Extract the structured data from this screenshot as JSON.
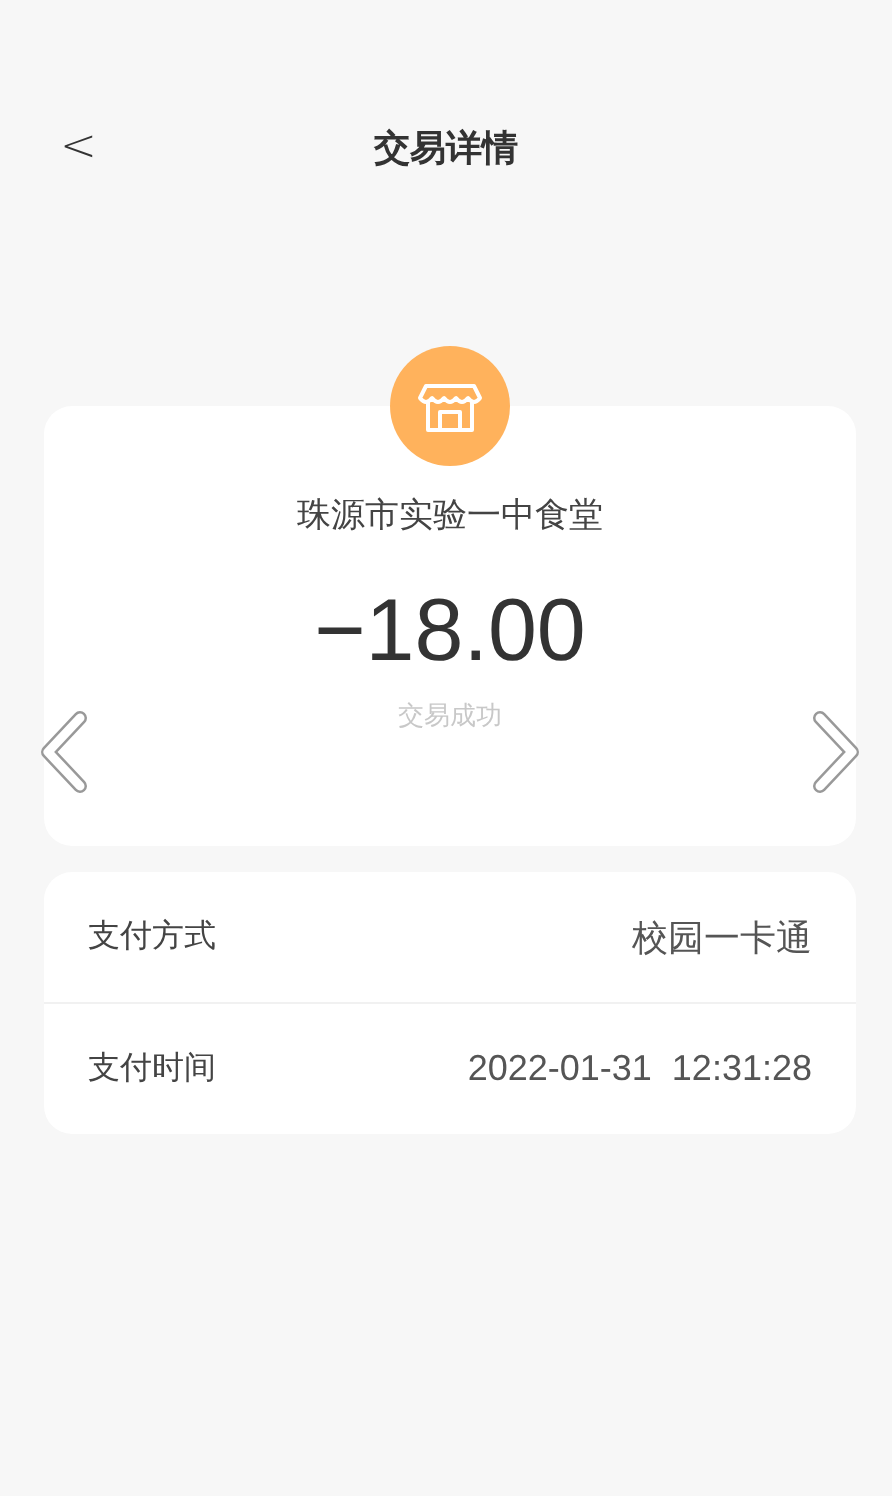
{
  "header": {
    "back": "<",
    "title": "交易详情"
  },
  "transaction": {
    "merchant": "珠源市实验一中食堂",
    "amount": "−18.00",
    "status": "交易成功"
  },
  "details": [
    {
      "label": "支付方式",
      "value": "校园一卡通"
    },
    {
      "label": "支付时间",
      "value": "2022-01-31  12:31:28"
    }
  ]
}
